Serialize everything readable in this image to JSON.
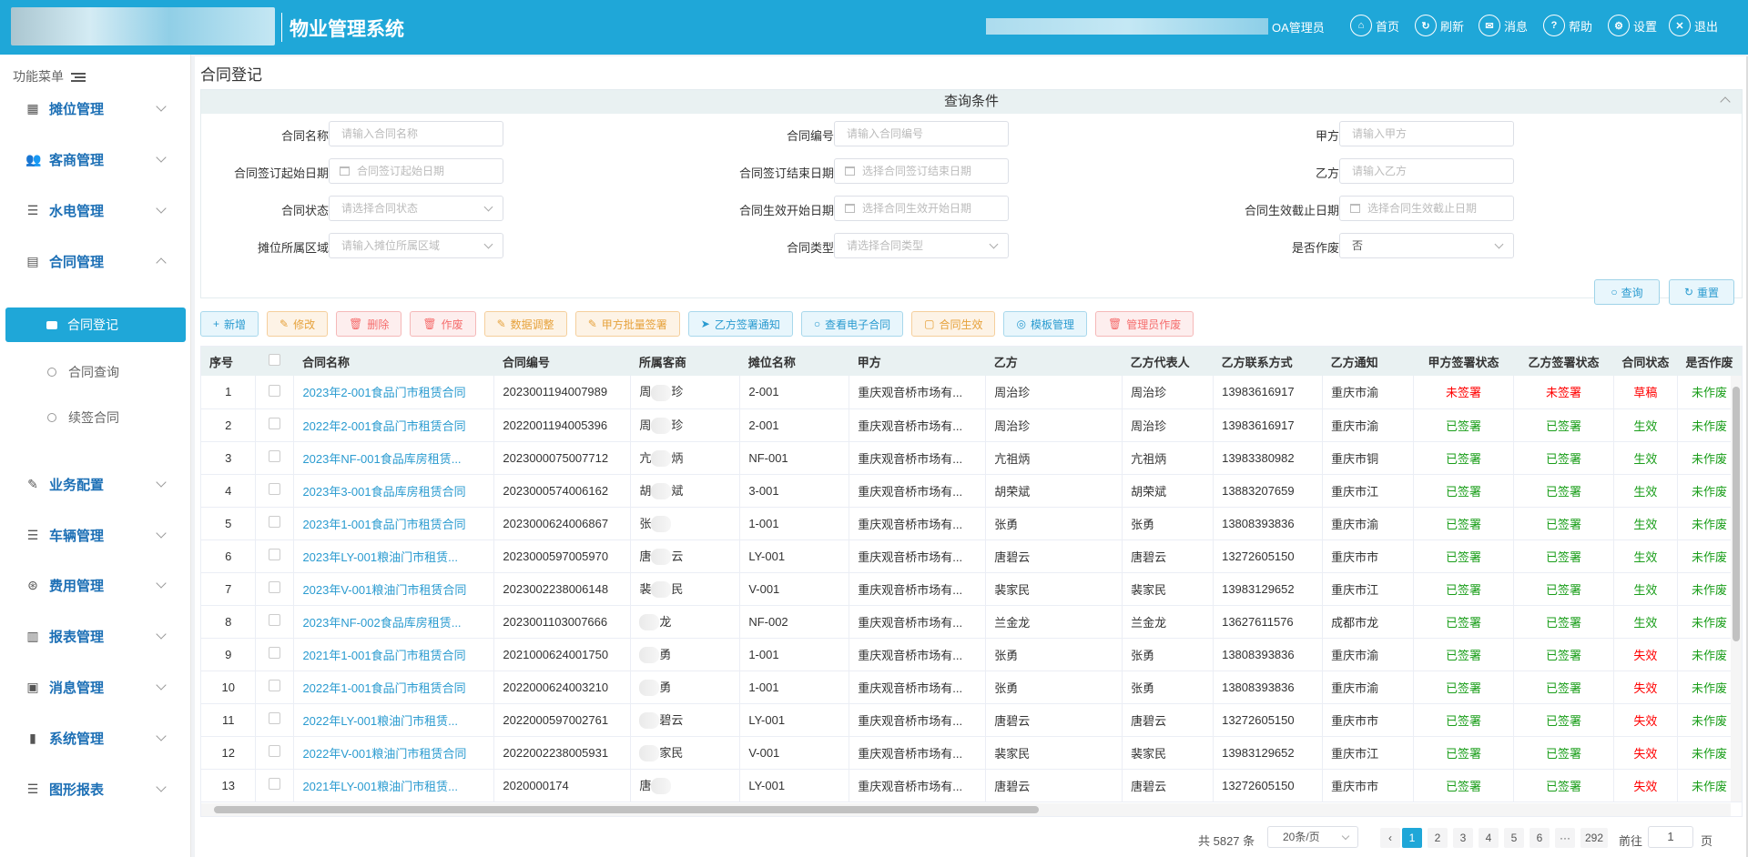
{
  "header": {
    "system_title": "物业管理系统",
    "user": "OA管理员",
    "nav": [
      {
        "icon": "home-icon",
        "glyph": "⌂",
        "label": "首页"
      },
      {
        "icon": "refresh-icon",
        "glyph": "↻",
        "label": "刷新"
      },
      {
        "icon": "mail-icon",
        "glyph": "✉",
        "label": "消息"
      },
      {
        "icon": "help-icon",
        "glyph": "?",
        "label": "帮助"
      },
      {
        "icon": "gear-icon",
        "glyph": "⚙",
        "label": "设置"
      },
      {
        "icon": "close-icon",
        "glyph": "✕",
        "label": "退出"
      }
    ]
  },
  "sidebar": {
    "title": "功能菜单",
    "items": [
      {
        "icon": "grid-icon",
        "glyph": "▦",
        "label": "摊位管理"
      },
      {
        "icon": "users-icon",
        "glyph": "👥",
        "label": "客商管理"
      },
      {
        "icon": "list-icon",
        "glyph": "☰",
        "label": "水电管理"
      },
      {
        "icon": "document-icon",
        "glyph": "▤",
        "label": "合同管理"
      },
      {
        "icon": "edit-icon",
        "glyph": "✎",
        "label": "业务配置"
      },
      {
        "icon": "list-icon",
        "glyph": "☰",
        "label": "车辆管理"
      },
      {
        "icon": "coin-icon",
        "glyph": "⊛",
        "label": "费用管理"
      },
      {
        "icon": "chart-icon",
        "glyph": "▥",
        "label": "报表管理"
      },
      {
        "icon": "briefcase-icon",
        "glyph": "▣",
        "label": "消息管理"
      },
      {
        "icon": "building-icon",
        "glyph": "▮",
        "label": "系统管理"
      },
      {
        "icon": "list-icon",
        "glyph": "☰",
        "label": "图形报表"
      }
    ],
    "sub_items": [
      "合同登记",
      "合同查询",
      "续签合同"
    ]
  },
  "page": {
    "title": "合同登记"
  },
  "query": {
    "title": "查询条件",
    "fields": [
      {
        "label": "合同名称",
        "placeholder": "请输入合同名称"
      },
      {
        "label": "合同编号",
        "placeholder": "请输入合同编号"
      },
      {
        "label": "甲方",
        "placeholder": "请输入甲方"
      },
      {
        "label": "合同签订起始日期",
        "placeholder": "合同签订起始日期"
      },
      {
        "label": "合同签订结束日期",
        "placeholder": "选择合同签订结束日期"
      },
      {
        "label": "乙方",
        "placeholder": "请输入乙方"
      },
      {
        "label": "合同状态",
        "placeholder": "请选择合同状态"
      },
      {
        "label": "合同生效开始日期",
        "placeholder": "选择合同生效开始日期"
      },
      {
        "label": "合同生效截止日期",
        "placeholder": "选择合同生效截止日期"
      },
      {
        "label": "摊位所属区域",
        "placeholder": "请输入摊位所属区域"
      },
      {
        "label": "合同类型",
        "placeholder": "请选择合同类型"
      },
      {
        "label": "是否作废",
        "value": "否"
      }
    ],
    "search_label": "查询",
    "reset_label": "重置"
  },
  "toolbar": [
    {
      "label": "新增",
      "glyph": "+",
      "icon": "plus-icon",
      "style": "blue"
    },
    {
      "label": "修改",
      "glyph": "✎",
      "icon": "edit-icon",
      "style": "orange"
    },
    {
      "label": "删除",
      "glyph": "🗑",
      "icon": "trash-icon",
      "style": "red"
    },
    {
      "label": "作废",
      "glyph": "🗑",
      "icon": "trash-icon",
      "style": "red"
    },
    {
      "label": "数据调整",
      "glyph": "✎",
      "icon": "edit-icon",
      "style": "orange"
    },
    {
      "label": "甲方批量签署",
      "glyph": "✎",
      "icon": "edit-icon",
      "style": "orange"
    },
    {
      "label": "乙方签署通知",
      "glyph": "➤",
      "icon": "send-icon",
      "style": "blue"
    },
    {
      "label": "查看电子合同",
      "glyph": "○",
      "icon": "search-icon",
      "style": "blue"
    },
    {
      "label": "合同生效",
      "glyph": "▢",
      "icon": "folder-icon",
      "style": "orange"
    },
    {
      "label": "模板管理",
      "glyph": "◎",
      "icon": "settings-icon",
      "style": "blue"
    },
    {
      "label": "管理员作废",
      "glyph": "🗑",
      "icon": "trash-icon",
      "style": "red"
    }
  ],
  "table": {
    "columns": [
      "序号",
      "",
      "合同名称",
      "合同编号",
      "所属客商",
      "摊位名称",
      "甲方",
      "乙方",
      "乙方代表人",
      "乙方联系方式",
      "乙方通知",
      "甲方签署状态",
      "乙方签署状态",
      "合同状态",
      "是否作废"
    ],
    "rows": [
      [
        "1",
        "2023年2-001食品门市租赁合同",
        "2023001194007989",
        "周",
        "珍",
        "2-001",
        "重庆观音桥市场有...",
        "周治珍",
        "周治珍",
        "13983616917",
        "重庆市渝",
        "未签署",
        "未签署",
        "草稿",
        "未作废"
      ],
      [
        "2",
        "2022年2-001食品门市租赁合同",
        "2022001194005396",
        "周",
        "珍",
        "2-001",
        "重庆观音桥市场有...",
        "周治珍",
        "周治珍",
        "13983616917",
        "重庆市渝",
        "已签署",
        "已签署",
        "生效",
        "未作废"
      ],
      [
        "3",
        "2023年NF-001食品库房租赁...",
        "2023000075007712",
        "亢",
        "炳",
        "NF-001",
        "重庆观音桥市场有...",
        "亢祖炳",
        "亢祖炳",
        "13983380982",
        "重庆市铜",
        "已签署",
        "已签署",
        "生效",
        "未作废"
      ],
      [
        "4",
        "2023年3-001食品库房租赁合同",
        "2023000574006162",
        "胡",
        "斌",
        "3-001",
        "重庆观音桥市场有...",
        "胡荣斌",
        "胡荣斌",
        "13883207659",
        "重庆市江",
        "已签署",
        "已签署",
        "生效",
        "未作废"
      ],
      [
        "5",
        "2023年1-001食品门市租赁合同",
        "2023000624006867",
        "张",
        "",
        "1-001",
        "重庆观音桥市场有...",
        "张勇",
        "张勇",
        "13808393836",
        "重庆市渝",
        "已签署",
        "已签署",
        "生效",
        "未作废"
      ],
      [
        "6",
        "2023年LY-001粮油门市租赁...",
        "2023000597005970",
        "唐",
        "云",
        "LY-001",
        "重庆观音桥市场有...",
        "唐碧云",
        "唐碧云",
        "13272605150",
        "重庆市市",
        "已签署",
        "已签署",
        "生效",
        "未作废"
      ],
      [
        "7",
        "2023年V-001粮油门市租赁合同",
        "2023002238006148",
        "裴",
        "民",
        "V-001",
        "重庆观音桥市场有...",
        "裴家民",
        "裴家民",
        "13983129652",
        "重庆市江",
        "已签署",
        "已签署",
        "生效",
        "未作废"
      ],
      [
        "8",
        "2023年NF-002食品库房租赁...",
        "2023001103007666",
        "",
        "龙",
        "NF-002",
        "重庆观音桥市场有...",
        "兰金龙",
        "兰金龙",
        "13627611576",
        "成都市龙",
        "已签署",
        "已签署",
        "生效",
        "未作废"
      ],
      [
        "9",
        "2021年1-001食品门市租赁合同",
        "2021000624001750",
        "",
        "勇",
        "1-001",
        "重庆观音桥市场有...",
        "张勇",
        "张勇",
        "13808393836",
        "重庆市渝",
        "已签署",
        "已签署",
        "失效",
        "未作废"
      ],
      [
        "10",
        "2022年1-001食品门市租赁合同",
        "2022000624003210",
        "",
        "勇",
        "1-001",
        "重庆观音桥市场有...",
        "张勇",
        "张勇",
        "13808393836",
        "重庆市渝",
        "已签署",
        "已签署",
        "失效",
        "未作废"
      ],
      [
        "11",
        "2022年LY-001粮油门市租赁...",
        "2022000597002761",
        "",
        "碧云",
        "LY-001",
        "重庆观音桥市场有...",
        "唐碧云",
        "唐碧云",
        "13272605150",
        "重庆市市",
        "已签署",
        "已签署",
        "失效",
        "未作废"
      ],
      [
        "12",
        "2022年V-001粮油门市租赁合同",
        "2022002238005931",
        "",
        "家民",
        "V-001",
        "重庆观音桥市场有...",
        "裴家民",
        "裴家民",
        "13983129652",
        "重庆市江",
        "已签署",
        "已签署",
        "失效",
        "未作废"
      ],
      [
        "13",
        "2021年LY-001粮油门市租赁...",
        "2020000174",
        "唐",
        "",
        "LY-001",
        "重庆观音桥市场有...",
        "唐碧云",
        "唐碧云",
        "13272605150",
        "重庆市市",
        "已签署",
        "已签署",
        "失效",
        "未作废"
      ]
    ]
  },
  "pagination": {
    "total": "共 5827 条",
    "page_size": "20条/页",
    "pages": [
      "1",
      "2",
      "3",
      "4",
      "5",
      "6",
      "···",
      "292"
    ],
    "goto_label": "前往",
    "goto_value": "1",
    "page_unit": "页"
  },
  "colors": {
    "primary": "#1fa7d8",
    "red": "#ff0000",
    "green": "#1a9e1a"
  }
}
